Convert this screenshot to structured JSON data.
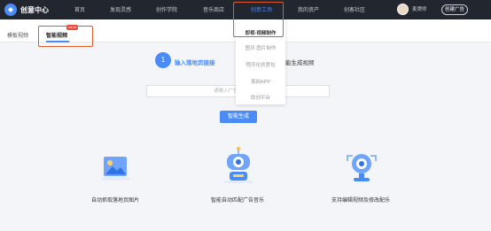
{
  "header": {
    "logo_text": "创意中心",
    "nav": [
      {
        "label": "首页"
      },
      {
        "label": "发现灵感"
      },
      {
        "label": "创作学院"
      },
      {
        "label": "音乐商店"
      },
      {
        "label": "创意工场"
      },
      {
        "label": "我的资产"
      },
      {
        "label": "创客社区"
      }
    ],
    "username": "麦牌师",
    "ad_button": "创建广告"
  },
  "dropdown": {
    "items": [
      {
        "label": "即视·视频制作"
      },
      {
        "label": "图灵·图片制作"
      },
      {
        "label": "程序化创意包"
      },
      {
        "label": "易拍APP"
      },
      {
        "label": "即创平台"
      }
    ]
  },
  "subnav": {
    "tabs": [
      {
        "label": "模板视频"
      },
      {
        "label": "智能视频"
      }
    ],
    "badge": "NEW"
  },
  "steps": {
    "step1_number": "1",
    "step1_label": "输入落地页链接",
    "step2_label": "能生成视频"
  },
  "form": {
    "url_placeholder": "请输入广告落地页链接",
    "submit_label": "智能生成"
  },
  "features": [
    {
      "label": "自动抓取落地页图片",
      "icon": "image-icon"
    },
    {
      "label": "智能自动匹配广告音乐",
      "icon": "robot-icon"
    },
    {
      "label": "支持编辑视频及修改配乐",
      "icon": "webcam-icon"
    }
  ],
  "colors": {
    "accent": "#4a8cf7",
    "nav_bg": "#22262e",
    "highlight": "#e05a2a",
    "badge": "#f0473b"
  }
}
